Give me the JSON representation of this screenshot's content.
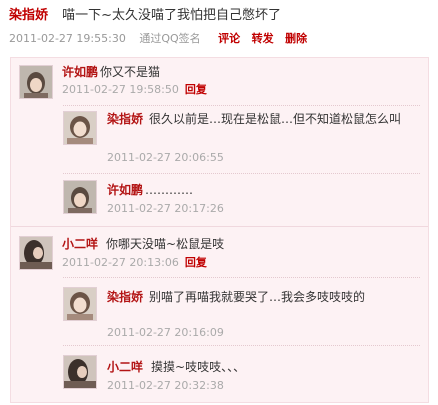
{
  "post": {
    "author": "染指娇",
    "text": "喵一下~太久没喵了我怕把自己憋坏了",
    "time": "2011-02-27 19:55:30",
    "source": "通过QQ签名",
    "actions": {
      "comment": "评论",
      "forward": "转发",
      "delete": "删除"
    }
  },
  "comments": [
    {
      "author": "许如鹏",
      "text": "你又不是猫",
      "time": "2011-02-27 19:58:50",
      "reply": "回复"
    },
    {
      "author": "染指娇",
      "text": "很久以前是…现在是松鼠…但不知道松鼠怎么叫",
      "time": "2011-02-27 20:06:55"
    },
    {
      "author": "许如鹏",
      "text": "…………",
      "time": "2011-02-27 20:17:26"
    },
    {
      "author": "小二咩",
      "text": "你哪天没喵~松鼠是吱",
      "time": "2011-02-27 20:13:06",
      "reply": "回复"
    },
    {
      "author": "染指娇",
      "text": "别喵了再喵我就要哭了…我会多吱吱吱的",
      "time": "2011-02-27 20:16:09"
    },
    {
      "author": "小二咩",
      "text": "摸摸~吱吱吱、、、",
      "time": "2011-02-27 20:32:38"
    }
  ]
}
